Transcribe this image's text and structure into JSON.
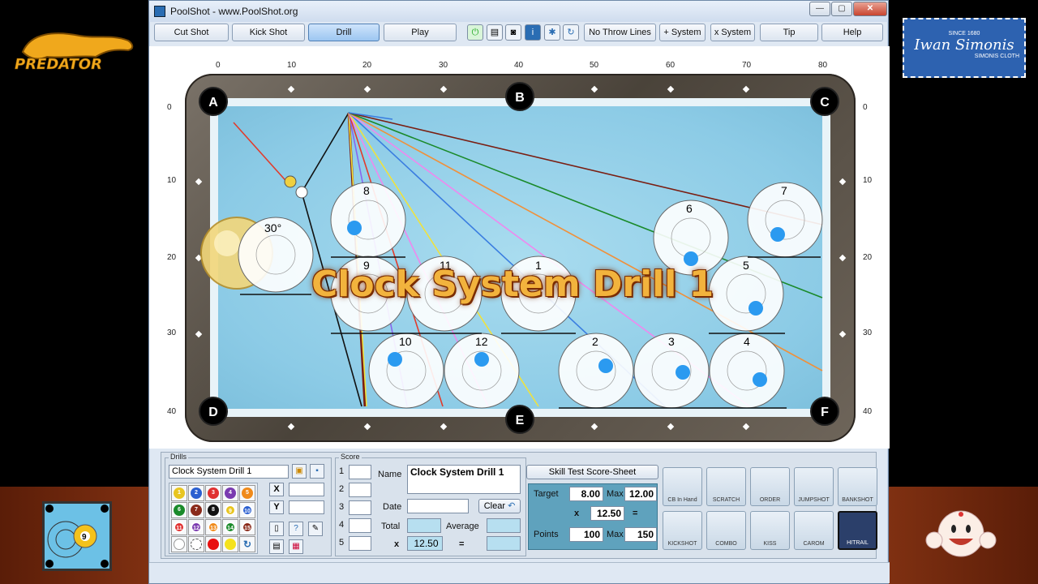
{
  "window": {
    "title": "PoolShot - www.PoolShot.org",
    "min": "—",
    "max": "▢",
    "close": "✕"
  },
  "toolbar": {
    "cut_shot": "Cut Shot",
    "kick_shot": "Kick Shot",
    "drill": "Drill",
    "play": "Play",
    "no_throw": "No Throw Lines",
    "plus_system": "+ System",
    "x_system": "x System",
    "tip": "Tip",
    "help": "Help"
  },
  "icons": [
    "power-icon",
    "print-icon",
    "camera-icon",
    "info-icon",
    "gear-icon",
    "refresh-icon"
  ],
  "ruler": {
    "top": [
      "0",
      "10",
      "20",
      "30",
      "40",
      "50",
      "60",
      "70",
      "80"
    ],
    "side": [
      "0",
      "10",
      "20",
      "30",
      "40"
    ]
  },
  "pockets": [
    "A",
    "B",
    "C",
    "D",
    "E",
    "F"
  ],
  "cue_ball_label": "30°",
  "target_numbers": [
    "1",
    "2",
    "3",
    "4",
    "5",
    "6",
    "7",
    "8",
    "9",
    "10",
    "11",
    "12"
  ],
  "drill_title": "Clock System Drill 1",
  "drills": {
    "label": "Drills",
    "selected": "Clock System Drill 1",
    "x_label": "X",
    "y_label": "Y",
    "x_value": "",
    "y_value": ""
  },
  "balls": [
    "1",
    "2",
    "3",
    "4",
    "5",
    "6",
    "7",
    "8",
    "9",
    "10",
    "11",
    "12",
    "13",
    "14",
    "15"
  ],
  "score": {
    "label": "Score",
    "rows": [
      "1",
      "2",
      "3",
      "4",
      "5"
    ],
    "name_label": "Name",
    "name_value": "Clock System Drill 1",
    "date_label": "Date",
    "date_value": "",
    "clear": "Clear",
    "total_label": "Total",
    "average_label": "Average",
    "x_label": "x",
    "multiplier": "12.50",
    "equals": "="
  },
  "skill": {
    "button": "Skill Test Score-Sheet",
    "target_label": "Target",
    "target_value": "8.00",
    "max_label": "Max",
    "max_value": "12.00",
    "x_label": "x",
    "x_value": "12.50",
    "eq": "=",
    "points_label": "Points",
    "points_value": "100",
    "points_max_label": "Max",
    "points_max_value": "150"
  },
  "shot_types": [
    "CB In Hand",
    "SCRATCH",
    "ORDER",
    "JUMPSHOT",
    "BANKSHOT",
    "KICKSHOT",
    "COMBO",
    "KISS",
    "CAROM",
    "HITRAIL"
  ],
  "logos": {
    "simonis_line1": "SINCE 1680",
    "simonis_line2": "Iwan Simonis",
    "simonis_line3": "SIMONIS CLOTH",
    "predator": "PREDATOR"
  }
}
